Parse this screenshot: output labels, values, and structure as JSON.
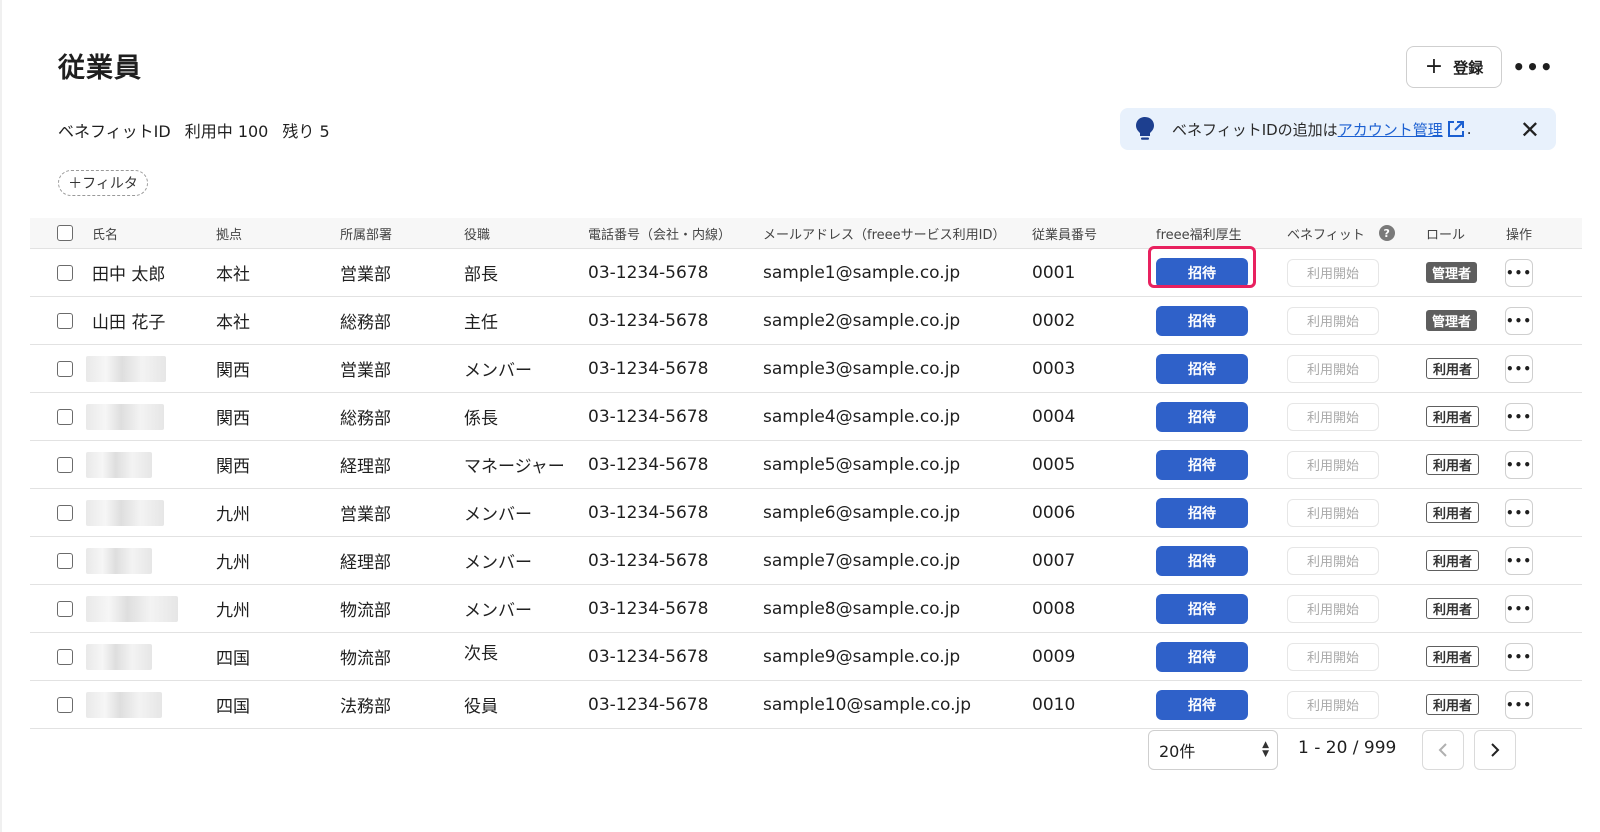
{
  "header": {
    "title": "従業員",
    "register_label": "登録",
    "more_label": "•••"
  },
  "usage": {
    "label": "ベネフィットID",
    "in_use": "利用中 100",
    "remaining": "残り 5"
  },
  "notice": {
    "text_before": "ベネフィットIDの追加は",
    "link_text": "アカウント管理",
    "text_after": "."
  },
  "filter": {
    "label": "＋フィルタ"
  },
  "table": {
    "columns": {
      "name": "氏名",
      "base": "拠点",
      "dept": "所属部署",
      "position": "役職",
      "phone": "電話番号（会社・内線）",
      "email": "メールアドレス（freeeサービス利用ID）",
      "emp_no": "従業員番号",
      "welfare": "freee福利厚生",
      "benefit": "ベネフィット",
      "role": "ロール",
      "ops": "操作"
    },
    "invite_label": "招待",
    "benefit_label": "利用開始",
    "ops_label": "•••",
    "rows": [
      {
        "name": "田中 太郎",
        "base": "本社",
        "dept": "営業部",
        "position": "部長",
        "phone": "03-1234-5678",
        "email": "sample1@sample.co.jp",
        "emp_no": "0001",
        "role": "管理者"
      },
      {
        "name": "山田 花子",
        "base": "本社",
        "dept": "総務部",
        "position": "主任",
        "phone": "03-1234-5678",
        "email": "sample2@sample.co.jp",
        "emp_no": "0002",
        "role": "管理者"
      },
      {
        "name": "",
        "base": "関西",
        "dept": "営業部",
        "position": "メンバー",
        "phone": "03-1234-5678",
        "email": "sample3@sample.co.jp",
        "emp_no": "0003",
        "role": "利用者"
      },
      {
        "name": "",
        "base": "関西",
        "dept": "総務部",
        "position": "係長",
        "phone": "03-1234-5678",
        "email": "sample4@sample.co.jp",
        "emp_no": "0004",
        "role": "利用者"
      },
      {
        "name": "",
        "base": "関西",
        "dept": "経理部",
        "position": "マネージャー",
        "phone": "03-1234-5678",
        "email": "sample5@sample.co.jp",
        "emp_no": "0005",
        "role": "利用者"
      },
      {
        "name": "",
        "base": "九州",
        "dept": "営業部",
        "position": "メンバー",
        "phone": "03-1234-5678",
        "email": "sample6@sample.co.jp",
        "emp_no": "0006",
        "role": "利用者"
      },
      {
        "name": "",
        "base": "九州",
        "dept": "経理部",
        "position": "メンバー",
        "phone": "03-1234-5678",
        "email": "sample7@sample.co.jp",
        "emp_no": "0007",
        "role": "利用者"
      },
      {
        "name": "",
        "base": "九州",
        "dept": "物流部",
        "position": "メンバー",
        "phone": "03-1234-5678",
        "email": "sample8@sample.co.jp",
        "emp_no": "0008",
        "role": "利用者"
      },
      {
        "name": "",
        "base": "四国",
        "dept": "物流部",
        "position": "次長",
        "phone": "03-1234-5678",
        "email": "sample9@sample.co.jp",
        "emp_no": "0009",
        "role": "利用者"
      },
      {
        "name": "",
        "base": "四国",
        "dept": "法務部",
        "position": "役員",
        "phone": "03-1234-5678",
        "email": "sample10@sample.co.jp",
        "emp_no": "0010",
        "role": "利用者"
      }
    ]
  },
  "pagination": {
    "per_page": "20件",
    "range": "1 - 20 / 999",
    "prev_icon": "chevron-left-icon",
    "next_icon": "chevron-right-icon"
  },
  "colors": {
    "invite_button": "#2f61c9",
    "highlight": "#e8215f",
    "notice_bg": "#e8f1fc",
    "link": "#1b5fd1"
  }
}
